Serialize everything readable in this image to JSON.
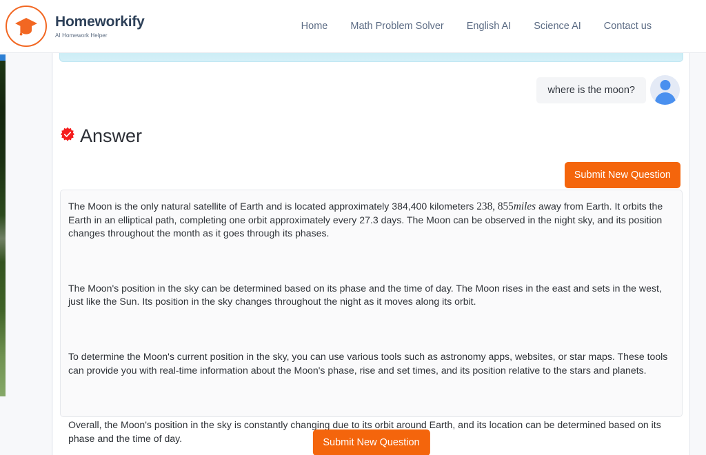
{
  "header": {
    "brand_name": "Homeworkify",
    "brand_tagline": "AI Homework Helper",
    "logo_icon": "graduation-cap-icon",
    "nav": [
      {
        "label": "Home"
      },
      {
        "label": "Math Problem Solver"
      },
      {
        "label": "English AI"
      },
      {
        "label": "Science AI"
      },
      {
        "label": "Contact us"
      }
    ]
  },
  "conversation": {
    "user_message": "where is the moon?",
    "avatar_icon": "user-avatar-icon"
  },
  "answer_section": {
    "badge_icon": "verified-starburst-icon",
    "title": "Answer",
    "submit_button_top": "Submit New Question",
    "submit_button_bottom": "Submit New Question",
    "paragraphs": {
      "p1_before_math": "The Moon is the only natural satellite of Earth and is located approximately 384,400 kilometers ",
      "p1_math_number": "238, 855",
      "p1_math_unit": "miles",
      "p1_after_math": " away from Earth. It orbits the Earth in an elliptical path, completing one orbit approximately every 27.3 days. The Moon can be observed in the night sky, and its position changes throughout the month as it goes through its phases.",
      "p2": "The Moon's position in the sky can be determined based on its phase and the time of day. The Moon rises in the east and sets in the west, just like the Sun. Its position in the sky changes throughout the night as it moves along its orbit.",
      "p3": "To determine the Moon's current position in the sky, you can use various tools such as astronomy apps, websites, or star maps. These tools can provide you with real-time information about the Moon's phase, rise and set times, and its position relative to the stars and planets.",
      "p4": "Overall, the Moon's position in the sky is constantly changing due to its orbit around Earth, and its location can be determined based on its phase and the time of day."
    }
  },
  "colors": {
    "brand_orange": "#f26722",
    "button_orange": "#f4650c",
    "nav_text": "#5b6b84",
    "brand_navy": "#2e4159",
    "badge_red": "#f51d1d",
    "avatar_blue": "#4a90ef",
    "panel_blue": "#c9ecf5"
  }
}
